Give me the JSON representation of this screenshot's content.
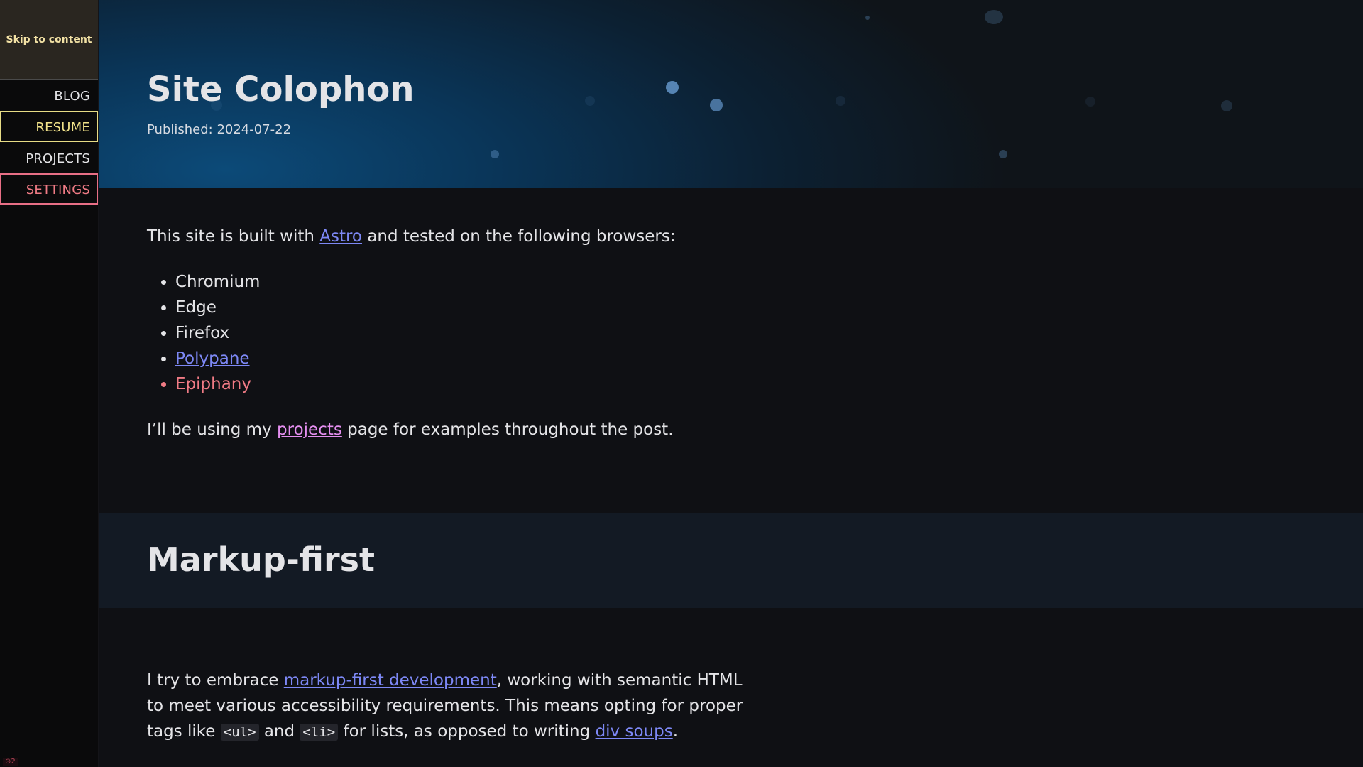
{
  "sidebar": {
    "skip_label": "Skip to content",
    "nav": [
      {
        "label": "BLOG"
      },
      {
        "label": "RESUME"
      },
      {
        "label": "PROJECTS"
      },
      {
        "label": "SETTINGS"
      }
    ],
    "footnote": "⊙2"
  },
  "hero": {
    "title": "Site Colophon",
    "published": "Published: 2024-07-22"
  },
  "intro": {
    "before": "This site is built with ",
    "astro_link": "Astro",
    "after": " and tested on the following browsers:"
  },
  "browsers": {
    "chromium": "Chromium",
    "edge": "Edge",
    "firefox": "Firefox",
    "polypane": "Polypane",
    "epiphany": "Epiphany"
  },
  "projects_para": {
    "before": "I’ll be using my ",
    "link": "projects",
    "after": " page for examples throughout the post."
  },
  "section": {
    "heading": "Markup-first"
  },
  "markup_para": {
    "t1": "I try to embrace ",
    "link1": "markup-first development",
    "t2": ", working with semantic HTML to meet various accessibility requirements. This means opting for proper tags like ",
    "code1": "<ul>",
    "t3": " and ",
    "code2": "<li>",
    "t4": " for lists, as opposed to writing ",
    "link2": "div soups",
    "t5": "."
  },
  "colors": {
    "link": "#7d88f5",
    "visited": "#e58ff0",
    "accent_yellow": "#e7dc86",
    "accent_red": "#f07b85"
  }
}
